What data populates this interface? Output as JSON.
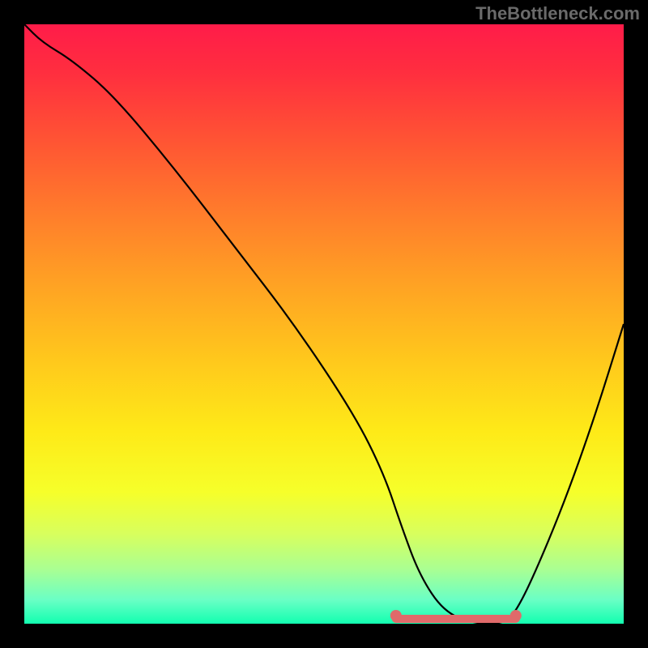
{
  "watermark": "TheBottleneck.com",
  "chart_data": {
    "type": "line",
    "title": "",
    "xlabel": "",
    "ylabel": "",
    "xlim": [
      0,
      100
    ],
    "ylim": [
      0,
      100
    ],
    "series": [
      {
        "name": "curve",
        "x": [
          0,
          3,
          8,
          15,
          25,
          35,
          45,
          55,
          60,
          63,
          66,
          70,
          75,
          80,
          82,
          85,
          90,
          95,
          100
        ],
        "values": [
          100,
          97,
          94,
          88,
          76,
          63,
          50,
          35,
          25,
          16,
          8,
          2,
          0,
          0,
          2,
          8,
          20,
          34,
          50
        ]
      }
    ],
    "highlight_segment": {
      "x_start": 62,
      "x_end": 82,
      "y": 0
    },
    "background_gradient": {
      "top": "#ff1c49",
      "bottom": "#12ffb0",
      "stops": [
        "#ff1c49",
        "#ff5633",
        "#ffa423",
        "#feea18",
        "#a9ff93",
        "#12ffb0"
      ]
    }
  }
}
